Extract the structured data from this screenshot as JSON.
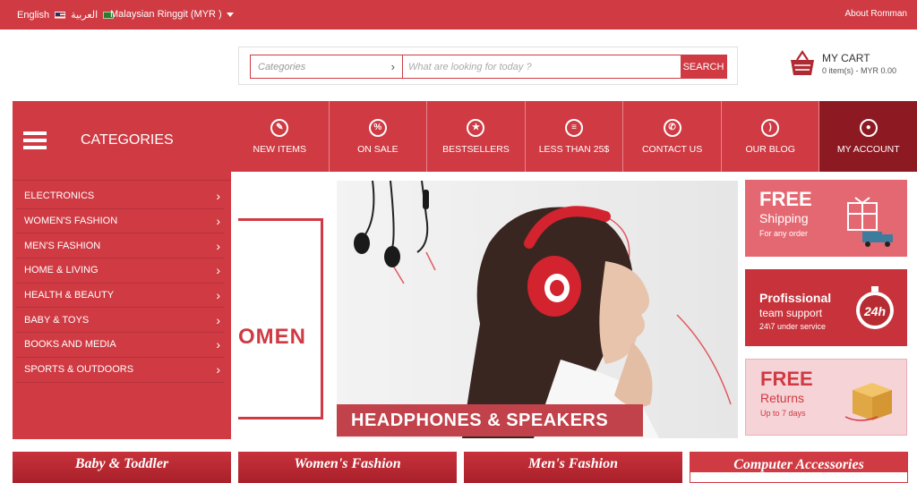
{
  "topbar": {
    "lang_en": "English",
    "lang_ar": "العربية",
    "currency": "Malaysian Ringgit (MYR )",
    "about": "About Romman"
  },
  "search": {
    "category_placeholder": "Categories",
    "placeholder": "What are looking for today ?",
    "button": "SEARCH"
  },
  "cart": {
    "title": "MY CART",
    "summary": "0 item(s) - MYR 0.00",
    "icon": "basket-icon"
  },
  "categories": {
    "title": "CATEGORIES",
    "items": [
      {
        "label": "ELECTRONICS"
      },
      {
        "label": "WOMEN'S FASHION"
      },
      {
        "label": "MEN'S FASHION"
      },
      {
        "label": "HOME & LIVING"
      },
      {
        "label": "HEALTH & BEAUTY"
      },
      {
        "label": "BABY & TOYS"
      },
      {
        "label": "BOOKS AND MEDIA"
      },
      {
        "label": "SPORTS & OUTDOORS"
      }
    ]
  },
  "nav": [
    {
      "label": "NEW ITEMS",
      "icon": "tag-icon",
      "glyph": "✎"
    },
    {
      "label": "ON SALE",
      "icon": "percent-icon",
      "glyph": "%"
    },
    {
      "label": "BESTSELLERS",
      "icon": "star-icon",
      "glyph": "★"
    },
    {
      "label": "LESS THAN 25$",
      "icon": "list-icon",
      "glyph": "≡"
    },
    {
      "label": "CONTACT US",
      "icon": "phone-icon",
      "glyph": "✆"
    },
    {
      "label": "OUR BLOG",
      "icon": "rss-icon",
      "glyph": ")"
    },
    {
      "label": "MY ACCOUNT",
      "icon": "user-icon",
      "glyph": "●"
    }
  ],
  "slider": {
    "left_word": "OMEN",
    "banner": "HEADPHONES & SPEAKERS"
  },
  "promos": [
    {
      "big": "FREE",
      "med": "Shipping",
      "small": "For any order",
      "icon": "truck-icon"
    },
    {
      "big": "Profissional",
      "med": "team support",
      "small": "24\\7 under service",
      "icon": "24h-icon",
      "badge": "24h"
    },
    {
      "big": "FREE",
      "med": "Returns",
      "small": "Up to 7 days",
      "icon": "box-icon"
    }
  ],
  "category_tabs": [
    {
      "label": "Baby & Toddler"
    },
    {
      "label": "Women's Fashion"
    },
    {
      "label": "Men's Fashion"
    },
    {
      "label": "Computer Accessories"
    }
  ],
  "colors": {
    "brand_red": "#cf3a43",
    "dark_red": "#8d1a22"
  }
}
